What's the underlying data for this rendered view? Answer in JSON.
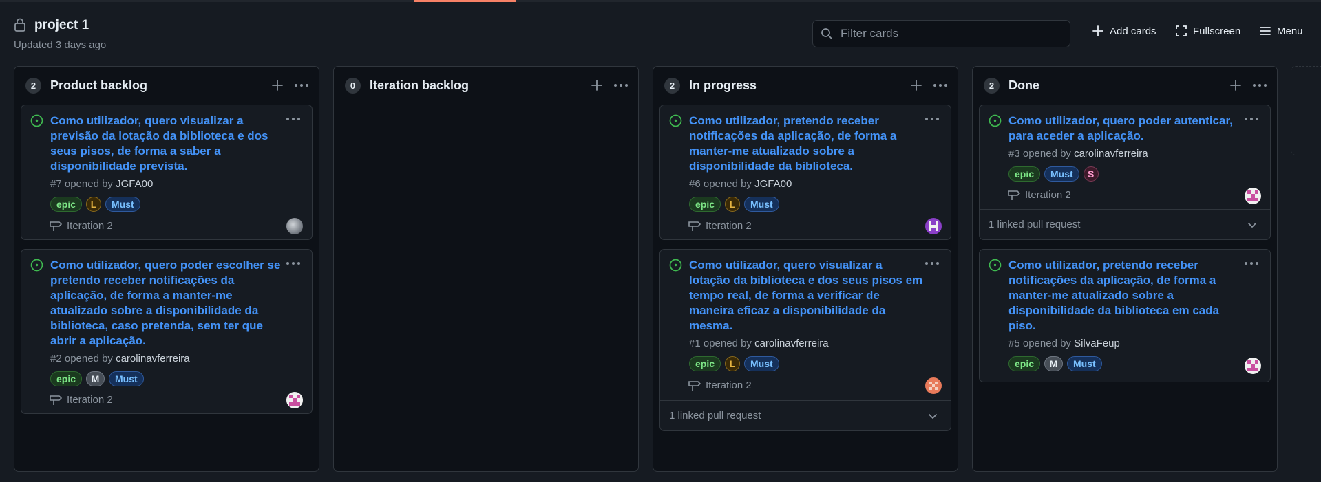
{
  "project": {
    "title": "project 1",
    "updated": "Updated 3 days ago"
  },
  "filter": {
    "placeholder": "Filter cards"
  },
  "actions": {
    "add_cards": "Add cards",
    "fullscreen": "Fullscreen",
    "menu": "Menu"
  },
  "colors": {
    "accent": "#f78166",
    "link": "#4493f8",
    "open_status": "#3fb950",
    "background": "#0d1117"
  },
  "columns": [
    {
      "count": "2",
      "title": "Product backlog",
      "cards": [
        {
          "title": "Como utilizador, quero visualizar a previsão da lotação da biblioteca e dos seus pisos, de forma a saber a disponibilidade prevista.",
          "number": "#7 opened by",
          "author": "JGFA00",
          "labels": [
            "epic",
            "L",
            "Must"
          ],
          "iteration": "Iteration 2",
          "avatar": "gray-avatar"
        },
        {
          "title": "Como utilizador, quero poder escolher se pretendo receber notificações da aplicação, de forma a manter-me atualizado sobre a disponibilidade da biblioteca, caso pretenda, sem ter que abrir a aplicação.",
          "number": "#2 opened by",
          "author": "carolinavferreira",
          "labels": [
            "epic",
            "M",
            "Must"
          ],
          "iteration": "Iteration 2",
          "avatar": "pink-avatar"
        }
      ]
    },
    {
      "count": "0",
      "title": "Iteration backlog",
      "cards": []
    },
    {
      "count": "2",
      "title": "In progress",
      "cards": [
        {
          "title": "Como utilizador, pretendo receber notificações da aplicação, de forma a manter-me atualizado sobre a disponibilidade da biblioteca.",
          "number": "#6 opened by",
          "author": "JGFA00",
          "labels": [
            "epic",
            "L",
            "Must"
          ],
          "iteration": "Iteration 2",
          "avatar": "purple-avatar"
        },
        {
          "title": "Como utilizador, quero visualizar a lotação da biblioteca e dos seus pisos em tempo real, de forma a verificar de maneira eficaz a disponibilidade da mesma.",
          "number": "#1 opened by",
          "author": "carolinavferreira",
          "labels": [
            "epic",
            "L",
            "Must"
          ],
          "iteration": "Iteration 2",
          "avatar": "orange-avatar",
          "linked": "1 linked pull request"
        }
      ]
    },
    {
      "count": "2",
      "title": "Done",
      "cards": [
        {
          "title": "Como utilizador, quero poder autenticar, para aceder a aplicação.",
          "number": "#3 opened by",
          "author": "carolinavferreira",
          "labels": [
            "epic",
            "Must",
            "S"
          ],
          "iteration": "Iteration 2",
          "avatar": "pink-avatar",
          "linked": "1 linked pull request"
        },
        {
          "title": "Como utilizador, pretendo receber notificações da aplicação, de forma a manter-me atualizado sobre a disponibilidade da biblioteca em cada piso.",
          "number": "#5 opened by",
          "author": "SilvaFeup",
          "labels": [
            "epic",
            "M",
            "Must"
          ],
          "avatar": "pink-avatar"
        }
      ]
    }
  ]
}
